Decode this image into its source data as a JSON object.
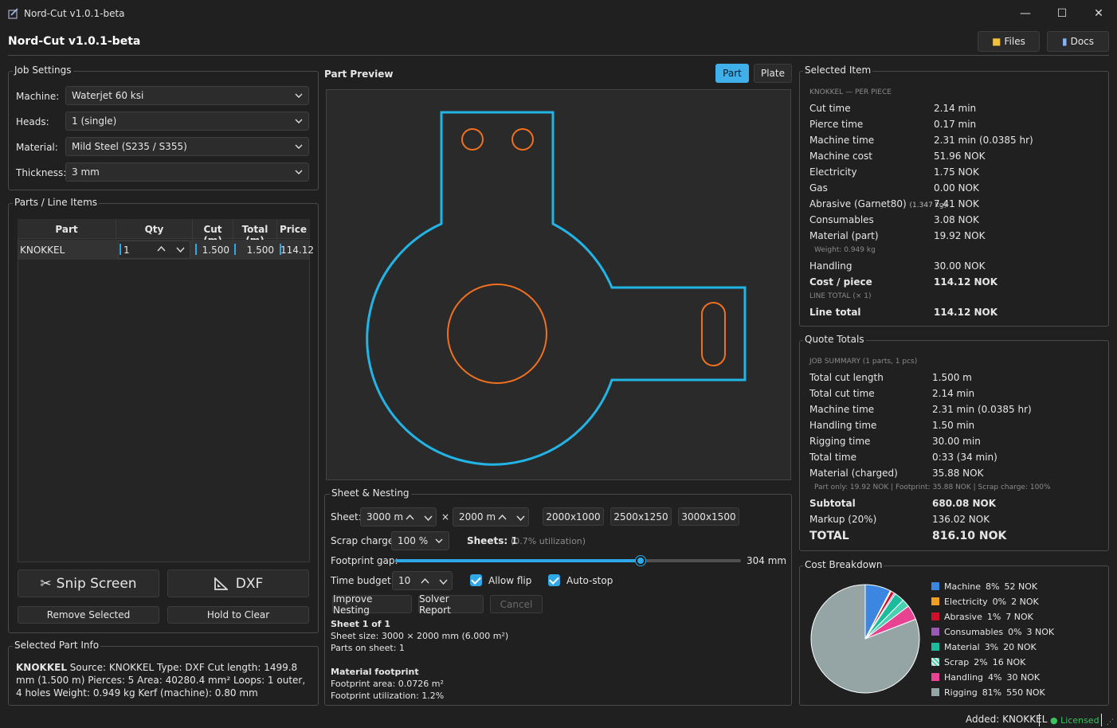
{
  "window": {
    "title": "Nord-Cut  v1.0.1-beta",
    "min": "—",
    "max": "☐",
    "close": "✕"
  },
  "header": {
    "title": "Nord-Cut  v1.0.1-beta",
    "files": "Files",
    "docs": "Docs"
  },
  "job": {
    "legend": "Job Settings",
    "machine_label": "Machine:",
    "machine": "Waterjet 60 ksi",
    "heads_label": "Heads:",
    "heads": "1 (single)",
    "material_label": "Material:",
    "material": "Mild Steel (S235 / S355)",
    "thickness_label": "Thickness:",
    "thickness": "3 mm"
  },
  "parts": {
    "legend": "Parts / Line Items",
    "cols": [
      "Part",
      "Qty",
      "Cut (m)",
      "Total (m)",
      "Price"
    ],
    "row": {
      "part": "KNOKKEL",
      "qty": "1",
      "cut": "1.500",
      "total": "1.500",
      "price": "114.12"
    },
    "snip": "Snip Screen",
    "dxf": "DXF",
    "remove": "Remove Selected",
    "hold": "Hold to Clear"
  },
  "info": {
    "legend": "Selected Part Info",
    "name": "KNOKKEL",
    "text": " Source: KNOKKEL Type: DXF Cut length: 1499.8 mm (1.500 m) Pierces: 5 Area: 40280.4 mm² Loops: 1 outer, 4 holes Weight: 0.949 kg Kerf (machine): 0.80 mm"
  },
  "preview": {
    "title": "Part Preview",
    "tab_part": "Part",
    "tab_plate": "Plate"
  },
  "nesting": {
    "legend": "Sheet & Nesting",
    "sheet_label": "Sheet:",
    "sheet_w": "3000 m",
    "x": "×",
    "sheet_h": "2000 m",
    "p1": "2000x1000",
    "p2": "2500x1250",
    "p3": "3000x1500",
    "scrap_label": "Scrap charge:",
    "scrap": "100 %",
    "sheets_label": "Sheets: 1",
    "util": "(0.7% utilization)",
    "gap_label": "Footprint gap:",
    "gap_val": "304 mm",
    "gap_fraction": 0.71,
    "time_label": "Time budget:",
    "time": "10 s",
    "allow_flip": "Allow flip",
    "auto_stop": "Auto-stop",
    "improve": "Improve Nesting",
    "report": "Solver Report",
    "cancel": "Cancel",
    "sheet_of": "Sheet 1 of 1",
    "sheet_size": "Sheet size: 3000 × 2000 mm (6.000 m²)",
    "parts_on": "Parts on sheet: 1",
    "foot_title": "Material footprint",
    "foot_area": "Footprint area: 0.0726 m²",
    "foot_util": "Footprint utilization: 1.2%"
  },
  "selected": {
    "legend": "Selected Item",
    "sub": "KNOKKEL — PER PIECE",
    "rows": [
      [
        "Cut time",
        "2.14 min"
      ],
      [
        "Pierce time",
        "0.17 min"
      ],
      [
        "Machine time",
        "2.31 min (0.0385 hr)"
      ],
      [
        "Machine cost",
        "51.96 NOK"
      ],
      [
        "Electricity",
        "1.75 NOK"
      ],
      [
        "Gas",
        "0.00 NOK"
      ],
      [
        "Abrasive (Garnet80)",
        "7.41 NOK"
      ],
      [
        "Consumables",
        "3.08 NOK"
      ],
      [
        "Material (part)",
        "19.92 NOK"
      ]
    ],
    "abrasive_kg": "(1.347 kg)",
    "weight": "Weight: 0.949 kg",
    "handling_l": "Handling",
    "handling_v": "30.00 NOK",
    "cpp_l": "Cost / piece",
    "cpp_v": "114.12 NOK",
    "line_total_sub": "LINE TOTAL (× 1)",
    "lt_l": "Line total",
    "lt_v": "114.12 NOK"
  },
  "quote": {
    "legend": "Quote Totals",
    "sub": "JOB SUMMARY (1 parts, 1 pcs)",
    "rows": [
      [
        "Total cut length",
        "1.500 m"
      ],
      [
        "Total cut time",
        "2.14 min"
      ],
      [
        "Machine time",
        "2.31 min (0.0385 hr)"
      ],
      [
        "Handling time",
        "1.50 min"
      ],
      [
        "Rigging time",
        "30.00 min"
      ],
      [
        "Total time",
        "0:33 (34 min)"
      ],
      [
        "Material (charged)",
        "35.88 NOK"
      ]
    ],
    "note": "Part only: 19.92 NOK  |  Footprint: 35.88 NOK  |  Scrap charge: 100%",
    "subtotal_l": "Subtotal",
    "subtotal_v": "680.08 NOK",
    "markup_l": "Markup (20%)",
    "markup_v": "136.02 NOK",
    "total_l": "TOTAL",
    "total_v": "816.10 NOK"
  },
  "breakdown": {
    "legend": "Cost Breakdown"
  },
  "chart_data": {
    "type": "pie",
    "slices": [
      {
        "label": "Machine",
        "pct": "8%",
        "value": 52,
        "color": "#3a86e0",
        "text": "52 NOK"
      },
      {
        "label": "Electricity",
        "pct": "0%",
        "value": 2,
        "color": "#f0a020",
        "text": "2 NOK"
      },
      {
        "label": "Abrasive",
        "pct": "1%",
        "value": 7,
        "color": "#d0102a",
        "text": "7 NOK"
      },
      {
        "label": "Consumables",
        "pct": "0%",
        "value": 3,
        "color": "#9b59b6",
        "text": "3 NOK"
      },
      {
        "label": "Material",
        "pct": "3%",
        "value": 20,
        "color": "#1abc9c",
        "text": "20 NOK"
      },
      {
        "label": "Scrap",
        "pct": "2%",
        "value": 16,
        "color": "#48d1b0",
        "text": "16 NOK"
      },
      {
        "label": "Handling",
        "pct": "4%",
        "value": 30,
        "color": "#e84393",
        "text": "30 NOK"
      },
      {
        "label": "Rigging",
        "pct": "81%",
        "value": 550,
        "color": "#95a5a6",
        "text": "550 NOK"
      }
    ]
  },
  "status": {
    "added": "Added: KNOKKEL",
    "licensed": "● Licensed"
  }
}
